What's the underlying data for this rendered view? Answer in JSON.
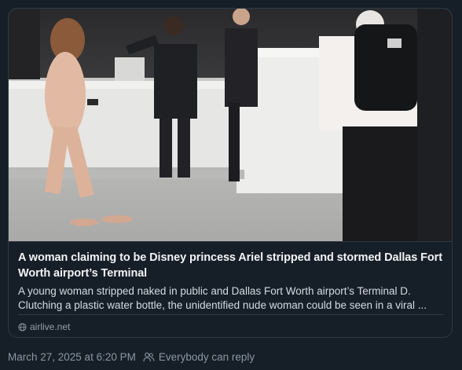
{
  "link_card": {
    "image_alt": "Airport terminal check-in counter scene",
    "title": "A woman claiming to be Disney princess Ariel stripped and stormed Dallas Fort Worth airport’s Terminal",
    "description_line1": "A young woman stripped naked in public and Dallas Fort Worth airport’s Terminal D.",
    "description_line2": "Clutching a plastic water bottle, the unidentified nude woman could be seen in a viral ...",
    "domain": "airlive.net",
    "domain_icon": "globe-icon"
  },
  "post_meta": {
    "timestamp": "March 27, 2025 at 6:20 PM",
    "reply_setting": "Everybody can reply",
    "reply_icon": "people-icon"
  },
  "colors": {
    "background": "#161e27",
    "border": "#2e3a47",
    "title_text": "#f1f3f5",
    "body_text": "#d4dbe2",
    "muted_text": "#8b98a5"
  }
}
